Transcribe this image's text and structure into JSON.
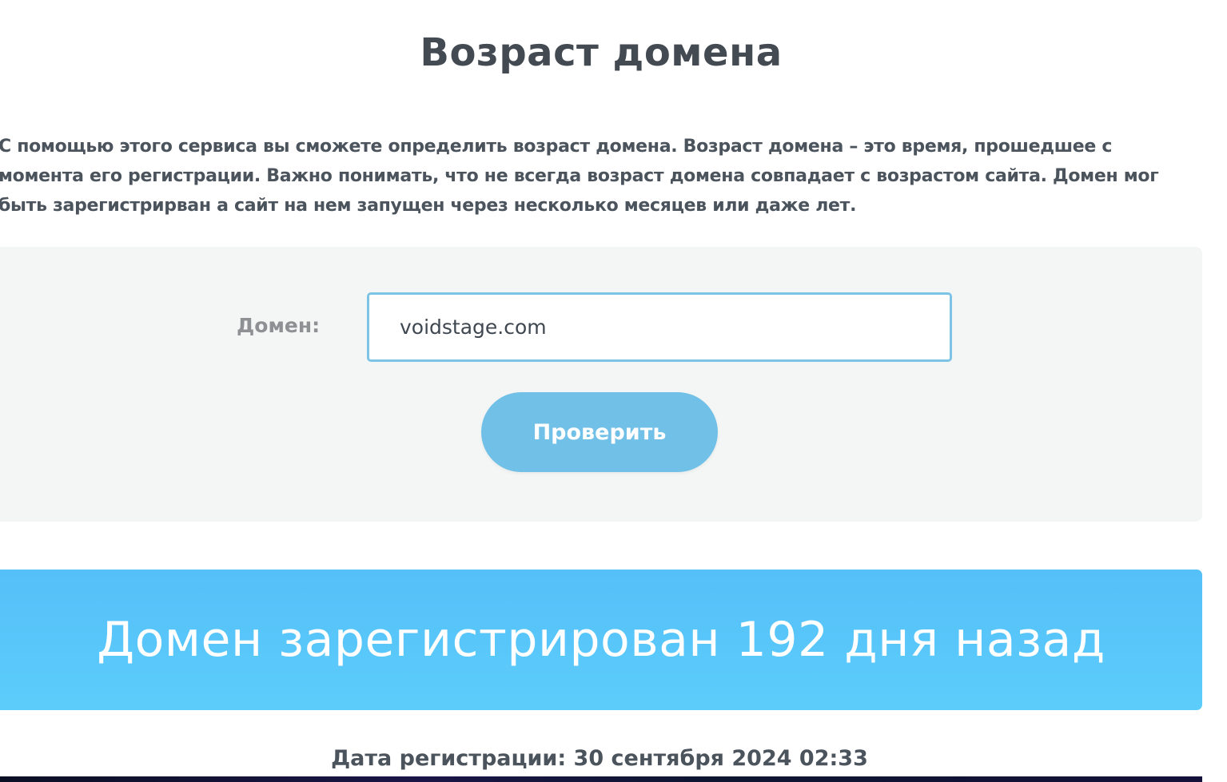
{
  "page": {
    "title": "Возраст домена",
    "description": "С помощью этого сервиса вы сможете определить возраст домена. Возраст домена – это время, прошедшее с момента его регистрации. Важно понимать, что не всегда возраст домена совпадает с возрастом сайта. Домен мог быть зарегистрирван а сайт на нем запущен через несколько месяцев или даже лет."
  },
  "form": {
    "domain_label": "Домен:",
    "domain_value": "voidstage.com",
    "submit_label": "Проверить"
  },
  "result": {
    "message": "Домен зарегистрирован 192 дня назад",
    "registration_date": "Дата регистрации: 30 сентября 2024 02:33"
  },
  "colors": {
    "accent": "#70c0e8",
    "banner": "#55bff8",
    "panel": "#f4f6f5",
    "input_border": "#7cc3e6"
  }
}
